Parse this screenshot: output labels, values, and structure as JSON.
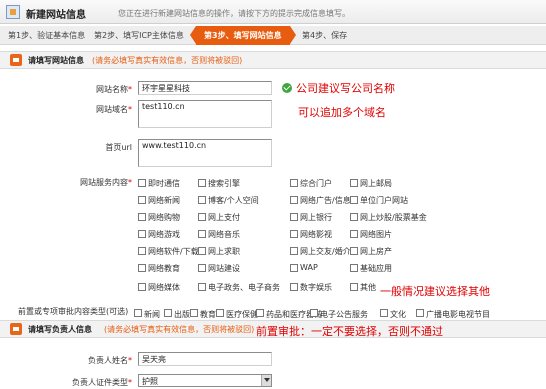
{
  "header": {
    "title": "新建网站信息",
    "hint": "您正在进行新建网站信息的操作，请按下方的提示完成信息填写。"
  },
  "steps": [
    "第1步、验证基本信息",
    "第2步、填写ICP主体信息",
    "第3步、填写网站信息",
    "第4步、保存"
  ],
  "site_section": {
    "title": "请填写网站信息",
    "note": "(请务必填写真实有效信息，否则将被驳回)"
  },
  "form": {
    "site_name_label": "网站名称",
    "site_name_value": "环宇星星科技",
    "site_domain_label": "网站域名",
    "site_domain_value": "test110.cn",
    "homepage_label": "首页url",
    "homepage_value": "www.test110.cn",
    "service_label": "网站服务内容",
    "required_mark": "*",
    "approval_label": "前置或专项审批内容类型(可选)"
  },
  "annotations": {
    "name_tip": "公司建议写公司名称",
    "domain_tip": "可以追加多个域名",
    "service_tip": "一般情况建议选择其他",
    "approval_tip": "前置审批：一定不要选择，否则不通过"
  },
  "services": [
    "即时通信",
    "搜索引擎",
    "综合门户",
    "网上邮局",
    "网络新闻",
    "博客/个人空间",
    "网络广告/信息",
    "单位门户网站",
    "网络购物",
    "网上支付",
    "网上银行",
    "网上炒股/股票基金",
    "网络游戏",
    "网络音乐",
    "网络影视",
    "网络图片",
    "网络软件/下载",
    "网上求职",
    "网上交友/婚介",
    "网上房产",
    "网络教育",
    "网站建设",
    "WAP",
    "基础应用",
    "网络媒体",
    "电子政务、电子商务",
    "数字娱乐",
    "其他"
  ],
  "approvals": [
    "新闻",
    "出版",
    "教育",
    "医疗保健",
    "药品和医疗器械",
    "电子公告服务",
    "文化",
    "广播电影电视节目"
  ],
  "person_section": {
    "title": "请填写负责人信息",
    "note": "(请务必填写真实有效信息，否则将被驳回)"
  },
  "person": {
    "name_label": "负责人姓名",
    "name_value": "吴天亮",
    "id_type_label": "负责人证件类型",
    "id_type_value": "护照"
  },
  "colors": {
    "accent": "#e85c10",
    "annotation": "#e00000",
    "ok": "#3fa53f"
  }
}
